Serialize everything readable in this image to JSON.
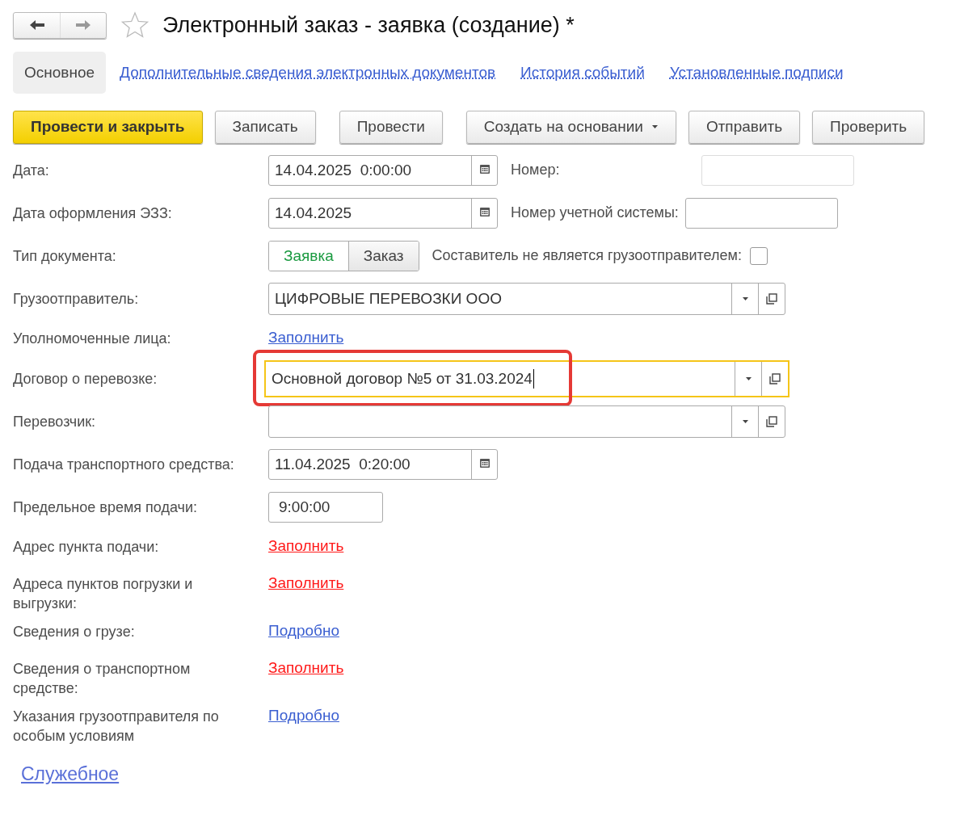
{
  "window": {
    "title": "Электронный заказ - заявка (создание) *",
    "favorite": false
  },
  "tabs": [
    {
      "label": "Основное",
      "selected": true
    },
    {
      "label": "Дополнительные сведения электронных документов",
      "selected": false
    },
    {
      "label": "История событий",
      "selected": false
    },
    {
      "label": "Установленные подписи",
      "selected": false
    }
  ],
  "toolbar": [
    {
      "label": "Провести и закрыть",
      "kind": "primary"
    },
    {
      "label": "Записать",
      "kind": "default"
    },
    {
      "label": "Провести",
      "kind": "default"
    },
    {
      "label": "Создать на основании",
      "kind": "menu"
    },
    {
      "label": "Отправить",
      "kind": "default"
    },
    {
      "label": "Проверить",
      "kind": "default"
    }
  ],
  "rows": [
    {
      "kind": "date",
      "label": "Дата:",
      "value": "14.04.2025  0:00:00",
      "side": {
        "label": "Номер:",
        "disabled": true
      }
    },
    {
      "kind": "date",
      "label": "Дата оформления ЭЗЗ:",
      "value": "14.04.2025",
      "side": {
        "label": "Номер учетной системы:",
        "disabled": false
      }
    },
    {
      "kind": "toggle",
      "label": "Тип документа:",
      "options": [
        {
          "label": "Заявка",
          "selected": true
        },
        {
          "label": "Заказ",
          "selected": false
        }
      ],
      "checkbox": {
        "label": "Составитель не является грузоотправителем:",
        "checked": false
      }
    },
    {
      "kind": "select",
      "label": "Грузоотправитель:",
      "value": "ЦИФРОВЫЕ ПЕРЕВОЗКИ ООО",
      "focused": false,
      "highlighted": false
    },
    {
      "kind": "link",
      "label": "Уполномоченные лица:",
      "link": "Заполнить",
      "required": false
    },
    {
      "kind": "select",
      "label": "Договор о перевозке:",
      "value": "Основной договор №5 от 31.03.2024",
      "focused": true,
      "highlighted": true
    },
    {
      "kind": "select",
      "label": "Перевозчик:",
      "value": "",
      "focused": false,
      "highlighted": false
    },
    {
      "kind": "date",
      "label": "Подача транспортного средства:",
      "value": "11.04.2025  0:20:00"
    },
    {
      "kind": "time",
      "label": "Предельное время подачи:",
      "value": "9:00:00"
    },
    {
      "kind": "link",
      "label": "Адрес пункта подачи:",
      "link": "Заполнить",
      "required": true
    },
    {
      "kind": "link",
      "label": "Адреса пунктов погрузки и выгрузки:",
      "link": "Заполнить",
      "required": true
    },
    {
      "kind": "link",
      "label": "Сведения о грузе:",
      "link": "Подробно",
      "required": false
    },
    {
      "kind": "link",
      "label": "Сведения о транспортном средстве:",
      "link": "Заполнить",
      "required": true
    },
    {
      "kind": "link",
      "label": "Указания грузоотправителя по особым условиям",
      "link": "Подробно",
      "required": false
    }
  ],
  "footer_link": "Служебное"
}
